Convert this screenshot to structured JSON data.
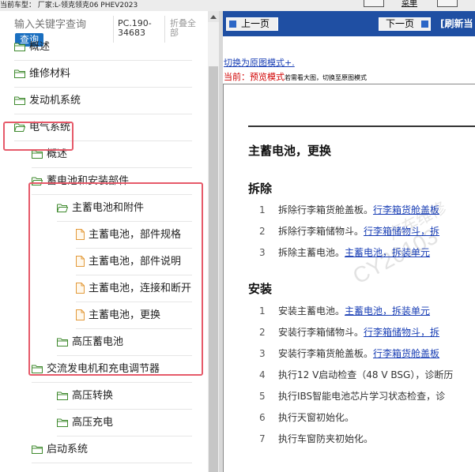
{
  "topbar": {
    "vehicle_label": "当前车型： 厂家:L-领克领克06 PHEV2023",
    "menu_label": "菜单"
  },
  "sidebar": {
    "search_placeholder": "输入关键字查询",
    "search_button": "查询",
    "model_code": "PC.190-34683",
    "collapse_all": "折叠全部",
    "items": [
      {
        "label": "概述",
        "icon": "folder-icon",
        "level": 0
      },
      {
        "label": "维修材料",
        "icon": "folder-icon",
        "level": 0
      },
      {
        "label": "发动机系统",
        "icon": "folder-icon",
        "level": 0
      },
      {
        "label": "电气系统",
        "icon": "folder-open-icon",
        "level": 0
      },
      {
        "label": "概述",
        "icon": "folder-icon",
        "level": 1
      },
      {
        "label": "蓄电池和安装部件",
        "icon": "folder-open-icon",
        "level": 1
      },
      {
        "label": "主蓄电池和附件",
        "icon": "folder-open-icon",
        "level": 2
      },
      {
        "label": "主蓄电池，部件规格",
        "icon": "document-icon",
        "level": 3
      },
      {
        "label": "主蓄电池，部件说明",
        "icon": "document-icon",
        "level": 3
      },
      {
        "label": "主蓄电池，连接和断开",
        "icon": "document-icon",
        "level": 3
      },
      {
        "label": "主蓄电池，更换",
        "icon": "document-icon",
        "level": 3
      },
      {
        "label": "高压蓄电池",
        "icon": "folder-icon",
        "level": 2
      },
      {
        "label": "交流发电机和充电调节器",
        "icon": "folder-icon",
        "level": 1
      },
      {
        "label": "高压转换",
        "icon": "folder-icon",
        "level": 2
      },
      {
        "label": "高压充电",
        "icon": "folder-icon",
        "level": 2
      },
      {
        "label": "启动系统",
        "icon": "folder-icon",
        "level": 1
      }
    ]
  },
  "content": {
    "prev_button": "上一页",
    "next_button": "下一页",
    "refresh_label": "[刷新当",
    "mode_link": "切换为原图模式+.",
    "mode_prefix": "当前：",
    "mode_current": "预览模式",
    "mode_hint": "若需看大图，切换至原图模式",
    "title": "主蓄电池，更换",
    "removal_heading": "拆除",
    "removal_steps": [
      {
        "num": "1",
        "text": "拆除行李箱货舱盖板。",
        "link": "行李箱货舱盖板"
      },
      {
        "num": "2",
        "text": "拆除行李箱储物斗。",
        "link": "行李箱储物斗，拆"
      },
      {
        "num": "3",
        "text": "拆除主蓄电池。",
        "link": "主蓄电池，拆装单元"
      }
    ],
    "install_heading": "安装",
    "install_steps": [
      {
        "num": "1",
        "text": "安装主蓄电池。",
        "link": "主蓄电池，拆装单元"
      },
      {
        "num": "2",
        "text": "安装行李箱储物斗。",
        "link": "行李箱储物斗，拆"
      },
      {
        "num": "3",
        "text": "安装行李箱货舱盖板。",
        "link": "行李箱货舱盖板"
      },
      {
        "num": "4",
        "text": "执行12 V启动检查（48 V BSG），诊断历",
        "link": ""
      },
      {
        "num": "5",
        "text": "执行IBS智能电池芯片学习状态检查，诊",
        "link": ""
      },
      {
        "num": "6",
        "text": "执行天窗初始化。",
        "link": ""
      },
      {
        "num": "7",
        "text": "执行车窗防夹初始化。",
        "link": ""
      }
    ],
    "watermark": "CY20103"
  }
}
